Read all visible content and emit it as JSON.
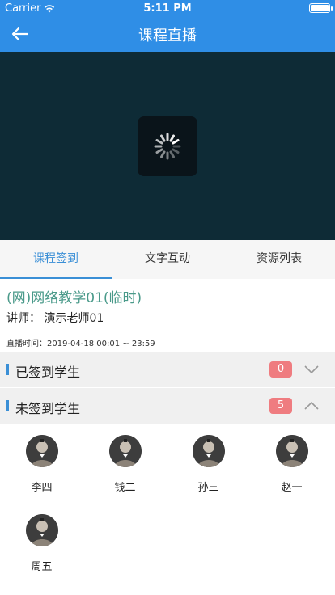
{
  "status_bar": {
    "carrier": "Carrier",
    "time": "5:11 PM",
    "wifi_icon": "wifi-icon",
    "battery_icon": "battery-icon"
  },
  "nav": {
    "title": "课程直播",
    "back_icon": "arrow-left-icon"
  },
  "video": {
    "loading_icon": "spinner-icon"
  },
  "tabs": [
    {
      "label": "课程签到",
      "active": true
    },
    {
      "label": "文字互动",
      "active": false
    },
    {
      "label": "资源列表",
      "active": false
    }
  ],
  "course": {
    "title": "(网)网络教学01(临时)",
    "teacher": "讲师：  演示老师01",
    "live_time": "直播时间：2019-04-18 00:01 ~  23:59"
  },
  "signed_section": {
    "label": "已签到学生",
    "count": "0",
    "chevron_icon": "chevron-down-icon"
  },
  "unsigned_section": {
    "label": "未签到学生",
    "count": "5",
    "chevron_icon": "chevron-up-icon"
  },
  "students": [
    {
      "name": "李四"
    },
    {
      "name": "钱二"
    },
    {
      "name": "孙三"
    },
    {
      "name": "赵一"
    },
    {
      "name": "周五"
    }
  ],
  "colors": {
    "primary": "#2f8ee6",
    "video_bg": "#0e2b36",
    "tab_active": "#3a8fd6",
    "course_title": "#4a9a8a",
    "badge": "#ef7c80"
  }
}
